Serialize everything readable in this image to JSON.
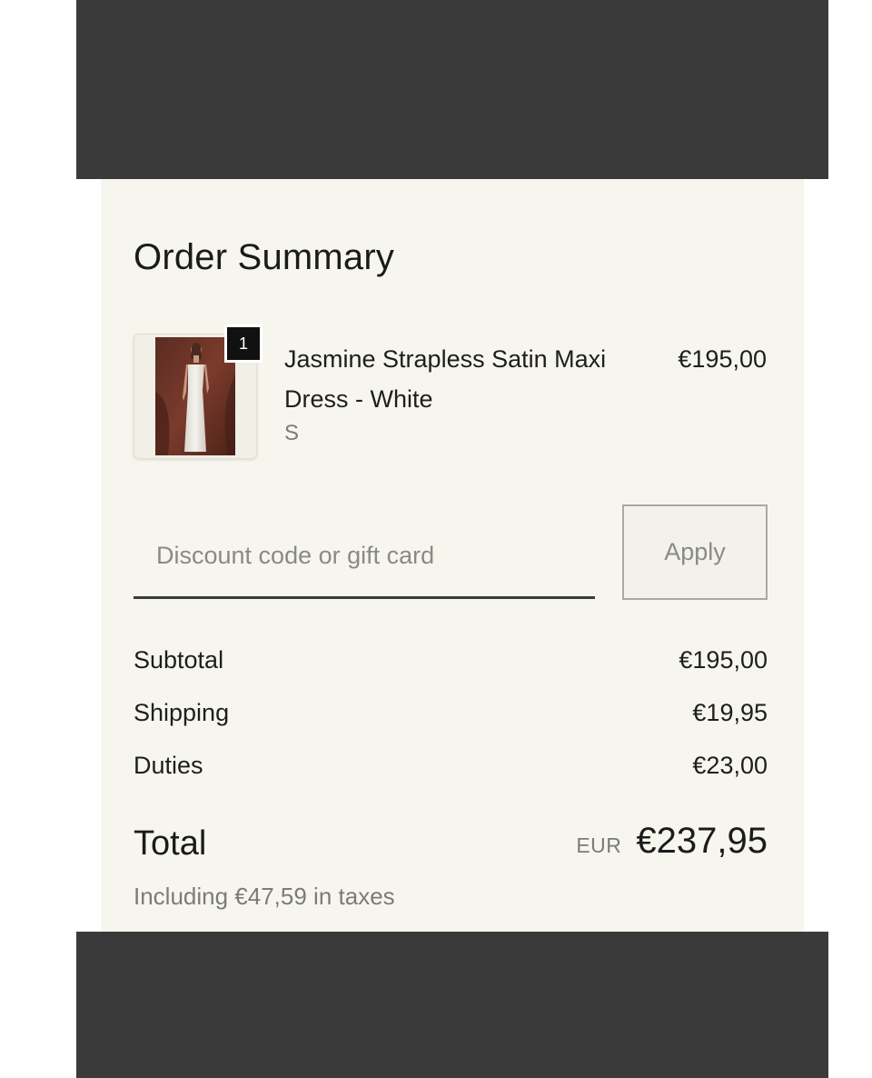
{
  "colors": {
    "frame": "#3a3a3a",
    "sheet_background": "#f7f6ee",
    "text_primary": "#1e1e1e",
    "text_muted": "#7b7b7b",
    "badge_background": "#111111"
  },
  "order_summary": {
    "title": "Order Summary"
  },
  "line_item": {
    "quantity_badge": "1",
    "name": "Jasmine Strapless Satin Maxi Dress - White",
    "variant": "S",
    "price": "€195,00",
    "image_icon": "product-photo-white-satin-dress"
  },
  "discount": {
    "placeholder": "Discount code or gift card",
    "value": "",
    "apply_label": "Apply"
  },
  "totals": {
    "subtotal_label": "Subtotal",
    "subtotal_value": "€195,00",
    "shipping_label": "Shipping",
    "shipping_value": "€19,95",
    "duties_label": "Duties",
    "duties_value": "€23,00",
    "total_label": "Total",
    "total_currency": "EUR",
    "total_value": "€237,95",
    "taxes_note": "Including €47,59 in taxes"
  }
}
